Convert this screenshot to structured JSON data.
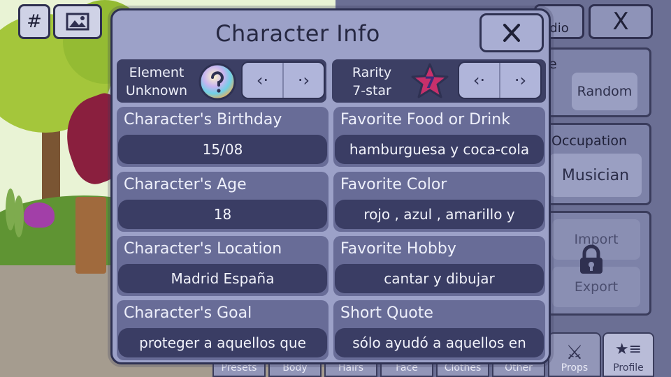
{
  "background": {
    "toolbar": {
      "hash_label": "#",
      "studio_label": "dio",
      "close_label": "X"
    },
    "right_panel": {
      "random_label": "Random",
      "occupation_label": "Occupation",
      "occupation_value": "Musician",
      "import_label": "Import",
      "export_label": "Export",
      "partial_letter": "e"
    },
    "tabs": [
      {
        "label": "Presets"
      },
      {
        "label": "Body"
      },
      {
        "label": "Hairs"
      },
      {
        "label": "Face"
      },
      {
        "label": "Clothes"
      },
      {
        "label": "Other"
      },
      {
        "label": "Props"
      },
      {
        "label": "Profile"
      }
    ]
  },
  "modal": {
    "title": "Character Info",
    "close_label": "X",
    "element": {
      "label_line1": "Element",
      "label_line2": "Unknown",
      "icon": "question-orb-icon"
    },
    "rarity": {
      "label_line1": "Rarity",
      "label_line2": "7-star",
      "icon_text": "7",
      "icon": "star-icon"
    },
    "fields": [
      {
        "label": "Character's Birthday",
        "value": "15/08"
      },
      {
        "label": "Favorite Food or Drink",
        "value": "hamburguesa y coca-cola"
      },
      {
        "label": "Character's Age",
        "value": "18"
      },
      {
        "label": "Favorite Color",
        "value": "rojo , azul , amarillo y"
      },
      {
        "label": "Character's Location",
        "value": "Madrid España"
      },
      {
        "label": "Favorite Hobby",
        "value": "cantar y dibujar"
      },
      {
        "label": "Character's Goal",
        "value": "proteger a aquellos que"
      },
      {
        "label": "Short Quote",
        "value": "sólo ayudó a aquellos en"
      }
    ]
  },
  "colors": {
    "modal_bg": "#9ca1c8",
    "field_bg": "#686c97",
    "value_bg": "#3a3d64",
    "border": "#2e3152"
  }
}
